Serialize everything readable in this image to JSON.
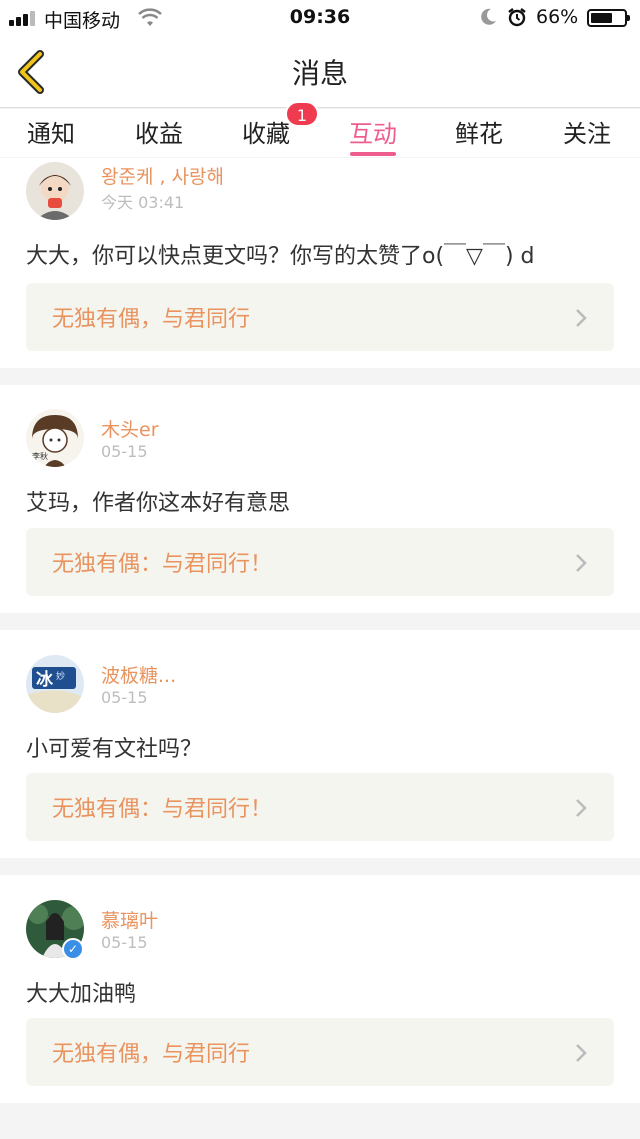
{
  "status_bar": {
    "carrier": "中国移动",
    "time": "09:36",
    "battery": "66%",
    "battery_level": 0.66,
    "icons": [
      "signal-icon",
      "wifi-icon",
      "moon-icon",
      "alarm-icon",
      "battery-icon"
    ]
  },
  "nav": {
    "title": "消息",
    "back_icon": "chevron-left-icon"
  },
  "tabs": [
    {
      "label": "通知"
    },
    {
      "label": "收益"
    },
    {
      "label": "收藏",
      "badge": "1"
    },
    {
      "label": "互动",
      "active": true
    },
    {
      "label": "鲜花"
    },
    {
      "label": "关注"
    }
  ],
  "messages": [
    {
      "name": "왕준케 , 사랑해",
      "date": "今天 03:41",
      "comment": "大大，你可以快点更文吗？你写的太赞了o(￣▽￣) d",
      "book": "无独有偶，与君同行"
    },
    {
      "name": "木头er",
      "date": "05-15",
      "comment": "艾玛，作者你这本好有意思",
      "book": "无独有偶：与君同行！"
    },
    {
      "name": "波板糖...",
      "date": "05-15",
      "comment": "小可爱有文社吗？",
      "book": "无独有偶：与君同行！"
    },
    {
      "name": "慕璃叶",
      "date": "05-15",
      "comment": "大大加油鸭",
      "book": "无独有偶，与君同行",
      "verified": true
    }
  ],
  "colors": {
    "accent": "#ef5d8f",
    "name": "#e9935f",
    "badge": "#ef3b4f",
    "book_bg": "#f5f5ef",
    "back": "#f0c419"
  }
}
